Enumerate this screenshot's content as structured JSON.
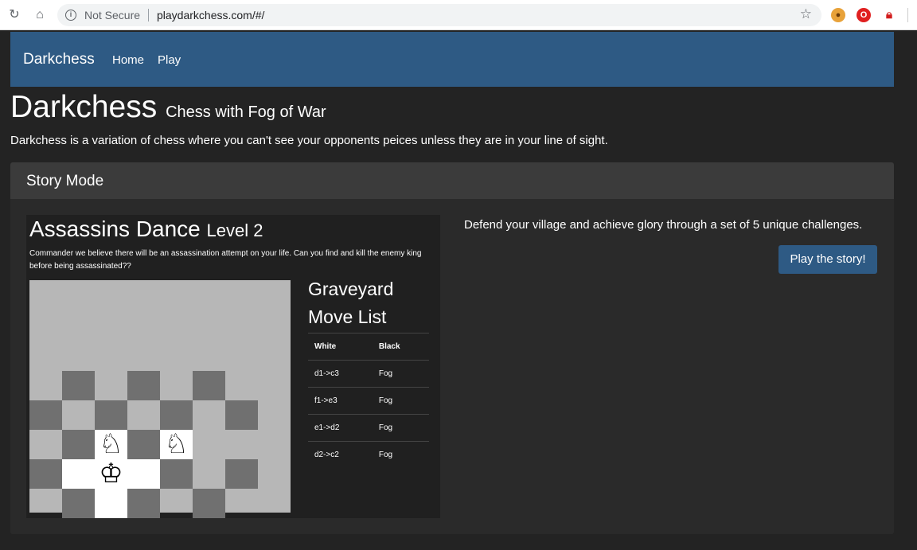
{
  "browser": {
    "security_label": "Not Secure",
    "url": "playdarkchess.com/#/",
    "back_icon": "reload-icon",
    "home_icon": "home-icon"
  },
  "navbar": {
    "brand": "Darkchess",
    "links": [
      "Home",
      "Play"
    ]
  },
  "header": {
    "title": "Darkchess",
    "subtitle": "Chess with Fog of War",
    "intro": "Darkchess is a variation of chess where you can't see your opponents peices unless they are in your line of sight."
  },
  "story": {
    "card_title": "Story Mode",
    "level_title": "Assassins Dance",
    "level_number": "Level 2",
    "level_description": "Commander we believe there will be an assassination attempt on your life. Can you find and kill the enemy king before being assassinated??",
    "graveyard_title": "Graveyard",
    "movelist_title": "Move List",
    "movelist_headers": [
      "White",
      "Black"
    ],
    "moves": [
      {
        "white": "d1->c3",
        "black": "Fog"
      },
      {
        "white": "f1->e3",
        "black": "Fog"
      },
      {
        "white": "e1->d2",
        "black": "Fog"
      },
      {
        "white": "d2->c2",
        "black": "Fog"
      }
    ],
    "promo_text": "Defend your village and achieve glory through a set of 5 unique challenges.",
    "play_button": "Play the story!"
  },
  "board": {
    "pieces": [
      {
        "symbol": "♘",
        "name": "white-knight",
        "square": "c3"
      },
      {
        "symbol": "♘",
        "name": "white-knight",
        "square": "e3"
      },
      {
        "symbol": "♔",
        "name": "white-king",
        "square": "c2"
      }
    ]
  },
  "colors": {
    "navbar": "#2e5a84",
    "button": "#2e5a84",
    "background": "#232323",
    "fog": "#b7b7b7"
  }
}
